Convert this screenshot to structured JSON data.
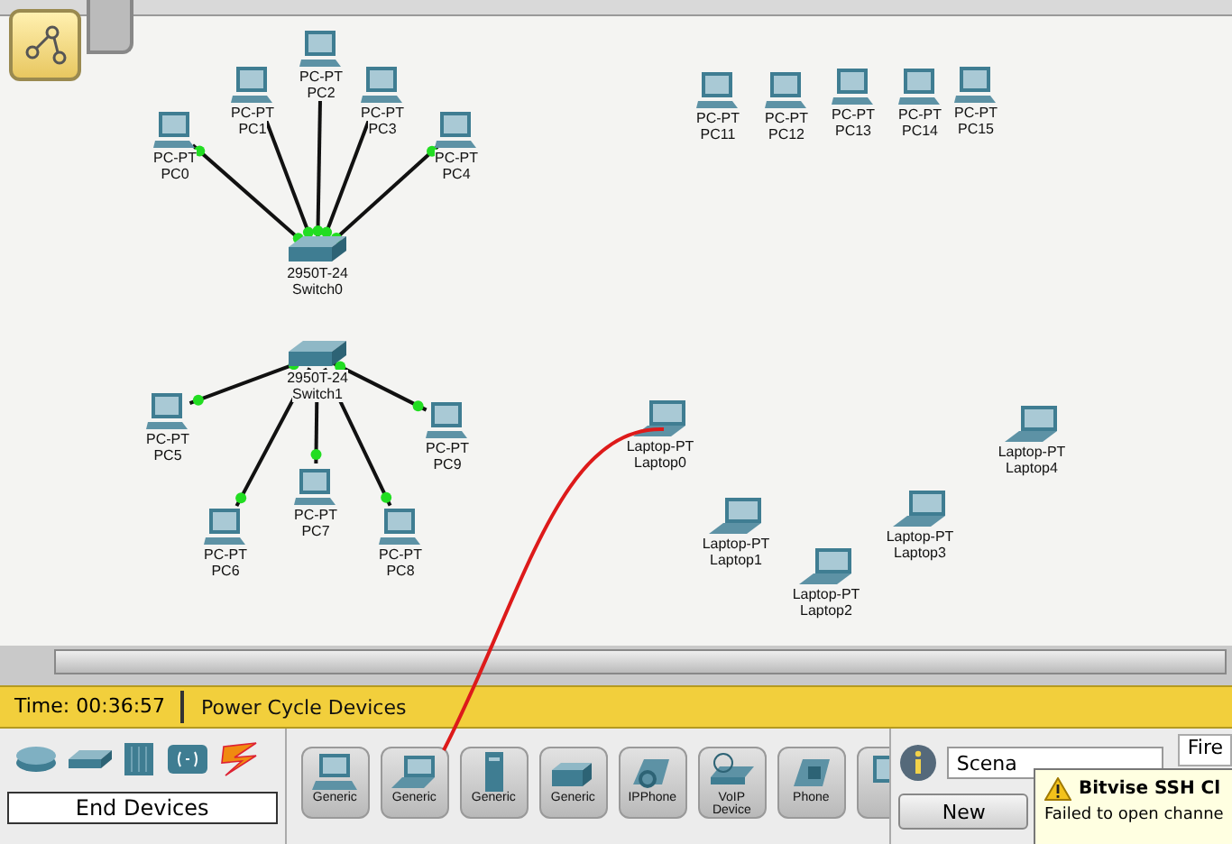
{
  "workspace": {
    "switches": [
      {
        "model": "2950T-24",
        "name": "Switch0",
        "children": [
          {
            "model": "PC-PT",
            "name": "PC0"
          },
          {
            "model": "PC-PT",
            "name": "PC1"
          },
          {
            "model": "PC-PT",
            "name": "PC2"
          },
          {
            "model": "PC-PT",
            "name": "PC3"
          },
          {
            "model": "PC-PT",
            "name": "PC4"
          }
        ]
      },
      {
        "model": "2950T-24",
        "name": "Switch1",
        "children": [
          {
            "model": "PC-PT",
            "name": "PC5"
          },
          {
            "model": "PC-PT",
            "name": "PC6"
          },
          {
            "model": "PC-PT",
            "name": "PC7"
          },
          {
            "model": "PC-PT",
            "name": "PC8"
          },
          {
            "model": "PC-PT",
            "name": "PC9"
          }
        ]
      }
    ],
    "standalone_pcs": [
      {
        "model": "PC-PT",
        "name": "PC11"
      },
      {
        "model": "PC-PT",
        "name": "PC12"
      },
      {
        "model": "PC-PT",
        "name": "PC13"
      },
      {
        "model": "PC-PT",
        "name": "PC14"
      },
      {
        "model": "PC-PT",
        "name": "PC15"
      }
    ],
    "laptops": [
      {
        "model": "Laptop-PT",
        "name": "Laptop0"
      },
      {
        "model": "Laptop-PT",
        "name": "Laptop1"
      },
      {
        "model": "Laptop-PT",
        "name": "Laptop2"
      },
      {
        "model": "Laptop-PT",
        "name": "Laptop3"
      },
      {
        "model": "Laptop-PT",
        "name": "Laptop4"
      }
    ]
  },
  "status_bar": {
    "time": "Time: 00:36:57",
    "action": "Power Cycle Devices"
  },
  "device_panel": {
    "category": "End Devices",
    "devices": [
      {
        "label": "Generic",
        "kind": "pc"
      },
      {
        "label": "Generic",
        "kind": "laptop"
      },
      {
        "label": "Generic",
        "kind": "server"
      },
      {
        "label": "Generic",
        "kind": "printer"
      },
      {
        "label": "IPPhone",
        "kind": "ipphone"
      },
      {
        "label": "VoIP Device",
        "kind": "voip"
      },
      {
        "label": "Phone",
        "kind": "phone"
      },
      {
        "kind": "tv"
      }
    ]
  },
  "scenario": {
    "value": "Scena",
    "new_button": "New",
    "column_1": "Fire"
  },
  "notification": {
    "title": "Bitvise SSH Cl",
    "message": "Failed to open channe"
  }
}
